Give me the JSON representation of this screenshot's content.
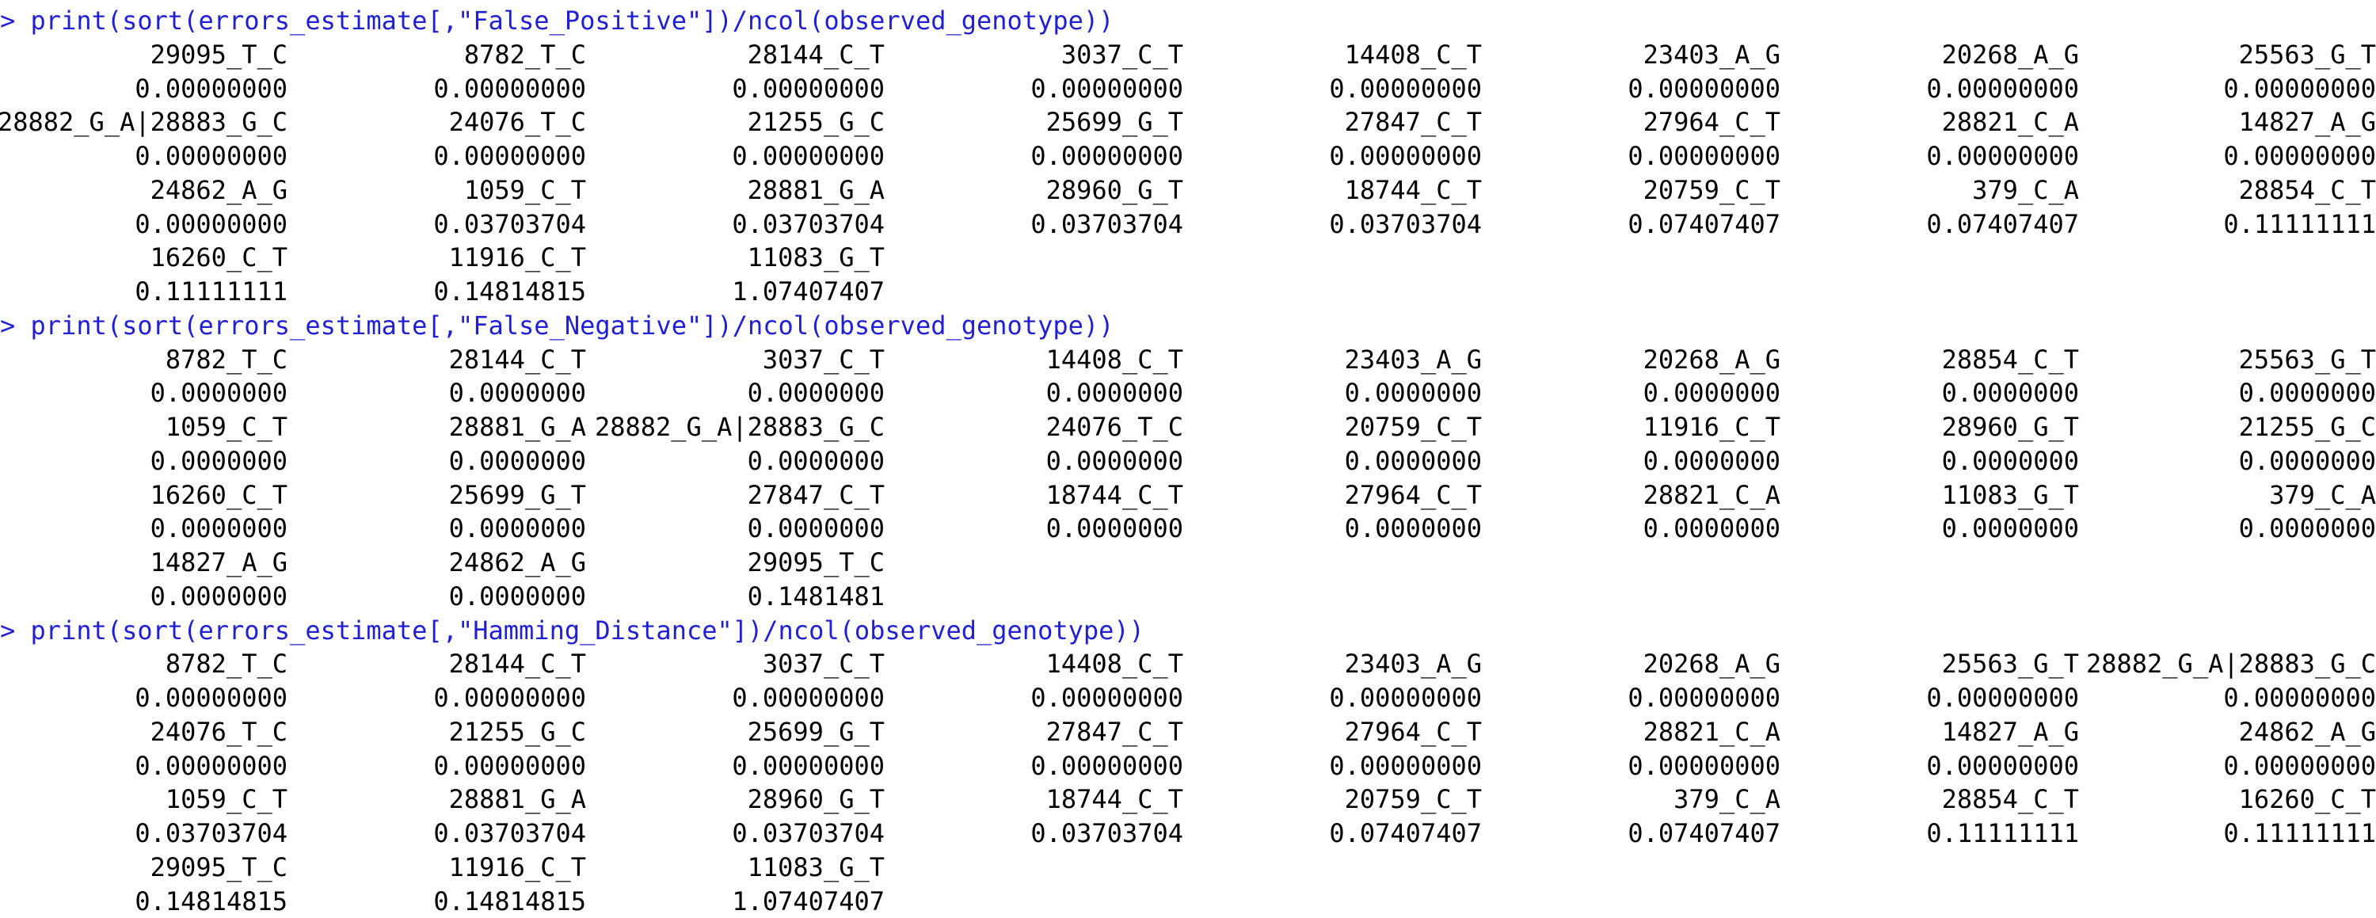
{
  "console": {
    "prompt_symbol": ">",
    "colors": {
      "prompt": "#1f1fd6",
      "output": "#000000",
      "background": "#ffffff"
    },
    "blocks": [
      {
        "command": "print(sort(errors_estimate[,\"False_Positive\"])/ncol(observed_genotype))",
        "rows": [
          {
            "names": [
              "29095_T_C",
              "8782_T_C",
              "28144_C_T",
              "3037_C_T",
              "14408_C_T",
              "23403_A_G",
              "20268_A_G",
              "25563_G_T"
            ],
            "values": [
              "0.00000000",
              "0.00000000",
              "0.00000000",
              "0.00000000",
              "0.00000000",
              "0.00000000",
              "0.00000000",
              "0.00000000"
            ]
          },
          {
            "names": [
              "28882_G_A|28883_G_C",
              "24076_T_C",
              "21255_G_C",
              "25699_G_T",
              "27847_C_T",
              "27964_C_T",
              "28821_C_A",
              "14827_A_G"
            ],
            "values": [
              "0.00000000",
              "0.00000000",
              "0.00000000",
              "0.00000000",
              "0.00000000",
              "0.00000000",
              "0.00000000",
              "0.00000000"
            ]
          },
          {
            "names": [
              "24862_A_G",
              "1059_C_T",
              "28881_G_A",
              "28960_G_T",
              "18744_C_T",
              "20759_C_T",
              "379_C_A",
              "28854_C_T"
            ],
            "values": [
              "0.00000000",
              "0.03703704",
              "0.03703704",
              "0.03703704",
              "0.03703704",
              "0.07407407",
              "0.07407407",
              "0.11111111"
            ]
          },
          {
            "names": [
              "16260_C_T",
              "11916_C_T",
              "11083_G_T"
            ],
            "values": [
              "0.11111111",
              "0.14814815",
              "1.07407407"
            ]
          }
        ]
      },
      {
        "command": "print(sort(errors_estimate[,\"False_Negative\"])/ncol(observed_genotype))",
        "rows": [
          {
            "names": [
              "8782_T_C",
              "28144_C_T",
              "3037_C_T",
              "14408_C_T",
              "23403_A_G",
              "20268_A_G",
              "28854_C_T",
              "25563_G_T"
            ],
            "values": [
              "0.0000000",
              "0.0000000",
              "0.0000000",
              "0.0000000",
              "0.0000000",
              "0.0000000",
              "0.0000000",
              "0.0000000"
            ]
          },
          {
            "names": [
              "1059_C_T",
              "28881_G_A",
              "28882_G_A|28883_G_C",
              "24076_T_C",
              "20759_C_T",
              "11916_C_T",
              "28960_G_T",
              "21255_G_C"
            ],
            "values": [
              "0.0000000",
              "0.0000000",
              "0.0000000",
              "0.0000000",
              "0.0000000",
              "0.0000000",
              "0.0000000",
              "0.0000000"
            ]
          },
          {
            "names": [
              "16260_C_T",
              "25699_G_T",
              "27847_C_T",
              "18744_C_T",
              "27964_C_T",
              "28821_C_A",
              "11083_G_T",
              "379_C_A"
            ],
            "values": [
              "0.0000000",
              "0.0000000",
              "0.0000000",
              "0.0000000",
              "0.0000000",
              "0.0000000",
              "0.0000000",
              "0.0000000"
            ]
          },
          {
            "names": [
              "14827_A_G",
              "24862_A_G",
              "29095_T_C"
            ],
            "values": [
              "0.0000000",
              "0.0000000",
              "0.1481481"
            ]
          }
        ]
      },
      {
        "command": "print(sort(errors_estimate[,\"Hamming_Distance\"])/ncol(observed_genotype))",
        "rows": [
          {
            "names": [
              "8782_T_C",
              "28144_C_T",
              "3037_C_T",
              "14408_C_T",
              "23403_A_G",
              "20268_A_G",
              "25563_G_T",
              "28882_G_A|28883_G_C"
            ],
            "values": [
              "0.00000000",
              "0.00000000",
              "0.00000000",
              "0.00000000",
              "0.00000000",
              "0.00000000",
              "0.00000000",
              "0.00000000"
            ]
          },
          {
            "names": [
              "24076_T_C",
              "21255_G_C",
              "25699_G_T",
              "27847_C_T",
              "27964_C_T",
              "28821_C_A",
              "14827_A_G",
              "24862_A_G"
            ],
            "values": [
              "0.00000000",
              "0.00000000",
              "0.00000000",
              "0.00000000",
              "0.00000000",
              "0.00000000",
              "0.00000000",
              "0.00000000"
            ]
          },
          {
            "names": [
              "1059_C_T",
              "28881_G_A",
              "28960_G_T",
              "18744_C_T",
              "20759_C_T",
              "379_C_A",
              "28854_C_T",
              "16260_C_T"
            ],
            "values": [
              "0.03703704",
              "0.03703704",
              "0.03703704",
              "0.03703704",
              "0.07407407",
              "0.07407407",
              "0.11111111",
              "0.11111111"
            ]
          },
          {
            "names": [
              "29095_T_C",
              "11916_C_T",
              "11083_G_T"
            ],
            "values": [
              "0.14814815",
              "0.14814815",
              "1.07407407"
            ]
          }
        ]
      }
    ]
  }
}
